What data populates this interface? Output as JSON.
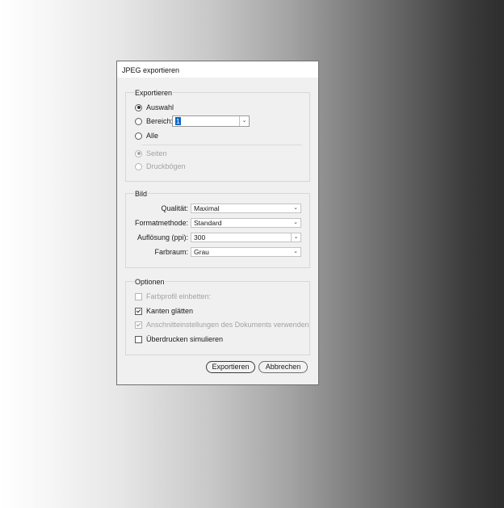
{
  "dialog": {
    "title": "JPEG exportieren"
  },
  "export_group": {
    "label": "Exportieren",
    "selection_label": "Auswahl",
    "range_label": "Bereich:",
    "range_value": "1",
    "all_label": "Alle",
    "pages_label": "Seiten",
    "spreads_label": "Druckbögen"
  },
  "image_group": {
    "label": "Bild",
    "quality_label": "Qualität:",
    "quality_value": "Maximal",
    "format_label": "Formatmethode:",
    "format_value": "Standard",
    "resolution_label": "Auflösung (ppi):",
    "resolution_value": "300",
    "colorspace_label": "Farbraum:",
    "colorspace_value": "Grau"
  },
  "options_group": {
    "label": "Optionen",
    "embed_profile_label": "Farbprofil einbetten:",
    "antialias_label": "Kanten glätten",
    "bleed_label": "Anschnitteinstellungen des Dokuments verwenden",
    "overprint_label": "Überdrucken simulieren"
  },
  "buttons": {
    "export_label": "Exportieren",
    "cancel_label": "Abbrechen"
  }
}
